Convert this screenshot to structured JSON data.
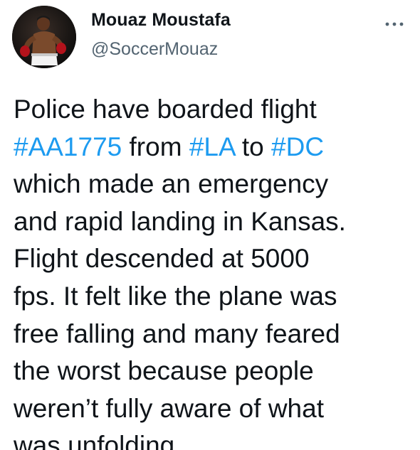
{
  "author": {
    "display_name": "Mouaz Moustafa",
    "handle": "@SoccerMouaz",
    "avatar_icon": "boxer-avatar"
  },
  "more_icon": "more-options-icon",
  "tweet": {
    "line1": "Police have boarded flight",
    "hashtag_flight": "#AA1775",
    "word_from": " from ",
    "hashtag_origin": "#LA",
    "word_to": " to ",
    "hashtag_destination": "#DC",
    "line3": "which made an emergency",
    "line4": "and rapid landing in Kansas.",
    "line5": "Flight descended at 5000",
    "line6": "fps. It felt like the plane was",
    "line7": "free falling and many feared",
    "line8": "the worst because people",
    "line9": "weren’t fully aware of what",
    "line10": "was unfolding"
  },
  "colors": {
    "text": "#0f1419",
    "secondary": "#536471",
    "link": "#1d9bf0"
  }
}
